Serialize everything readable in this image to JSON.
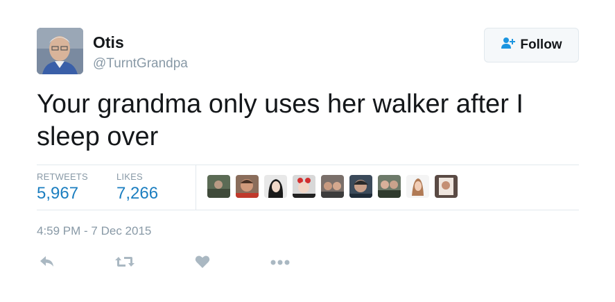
{
  "user": {
    "name": "Otis",
    "handle": "@TurntGrandpa"
  },
  "follow_button": {
    "label": "Follow",
    "icon": "add-user-icon"
  },
  "tweet": {
    "text": "Your grandma only uses her walker after I sleep over"
  },
  "stats": {
    "retweets_label": "RETWEETS",
    "retweets_value": "5,967",
    "likes_label": "LIKES",
    "likes_value": "7,266"
  },
  "likers_count": 9,
  "timestamp": "4:59 PM - 7 Dec 2015",
  "actions": [
    {
      "name": "reply",
      "icon": "reply-icon"
    },
    {
      "name": "retweet",
      "icon": "retweet-icon"
    },
    {
      "name": "like",
      "icon": "heart-icon"
    },
    {
      "name": "more",
      "icon": "more-icon"
    }
  ],
  "colors": {
    "link_blue": "#1b7ec0",
    "muted": "#8899a6",
    "text": "#14171a",
    "border": "#e1e8ed",
    "action_gray": "#aab8c2"
  }
}
